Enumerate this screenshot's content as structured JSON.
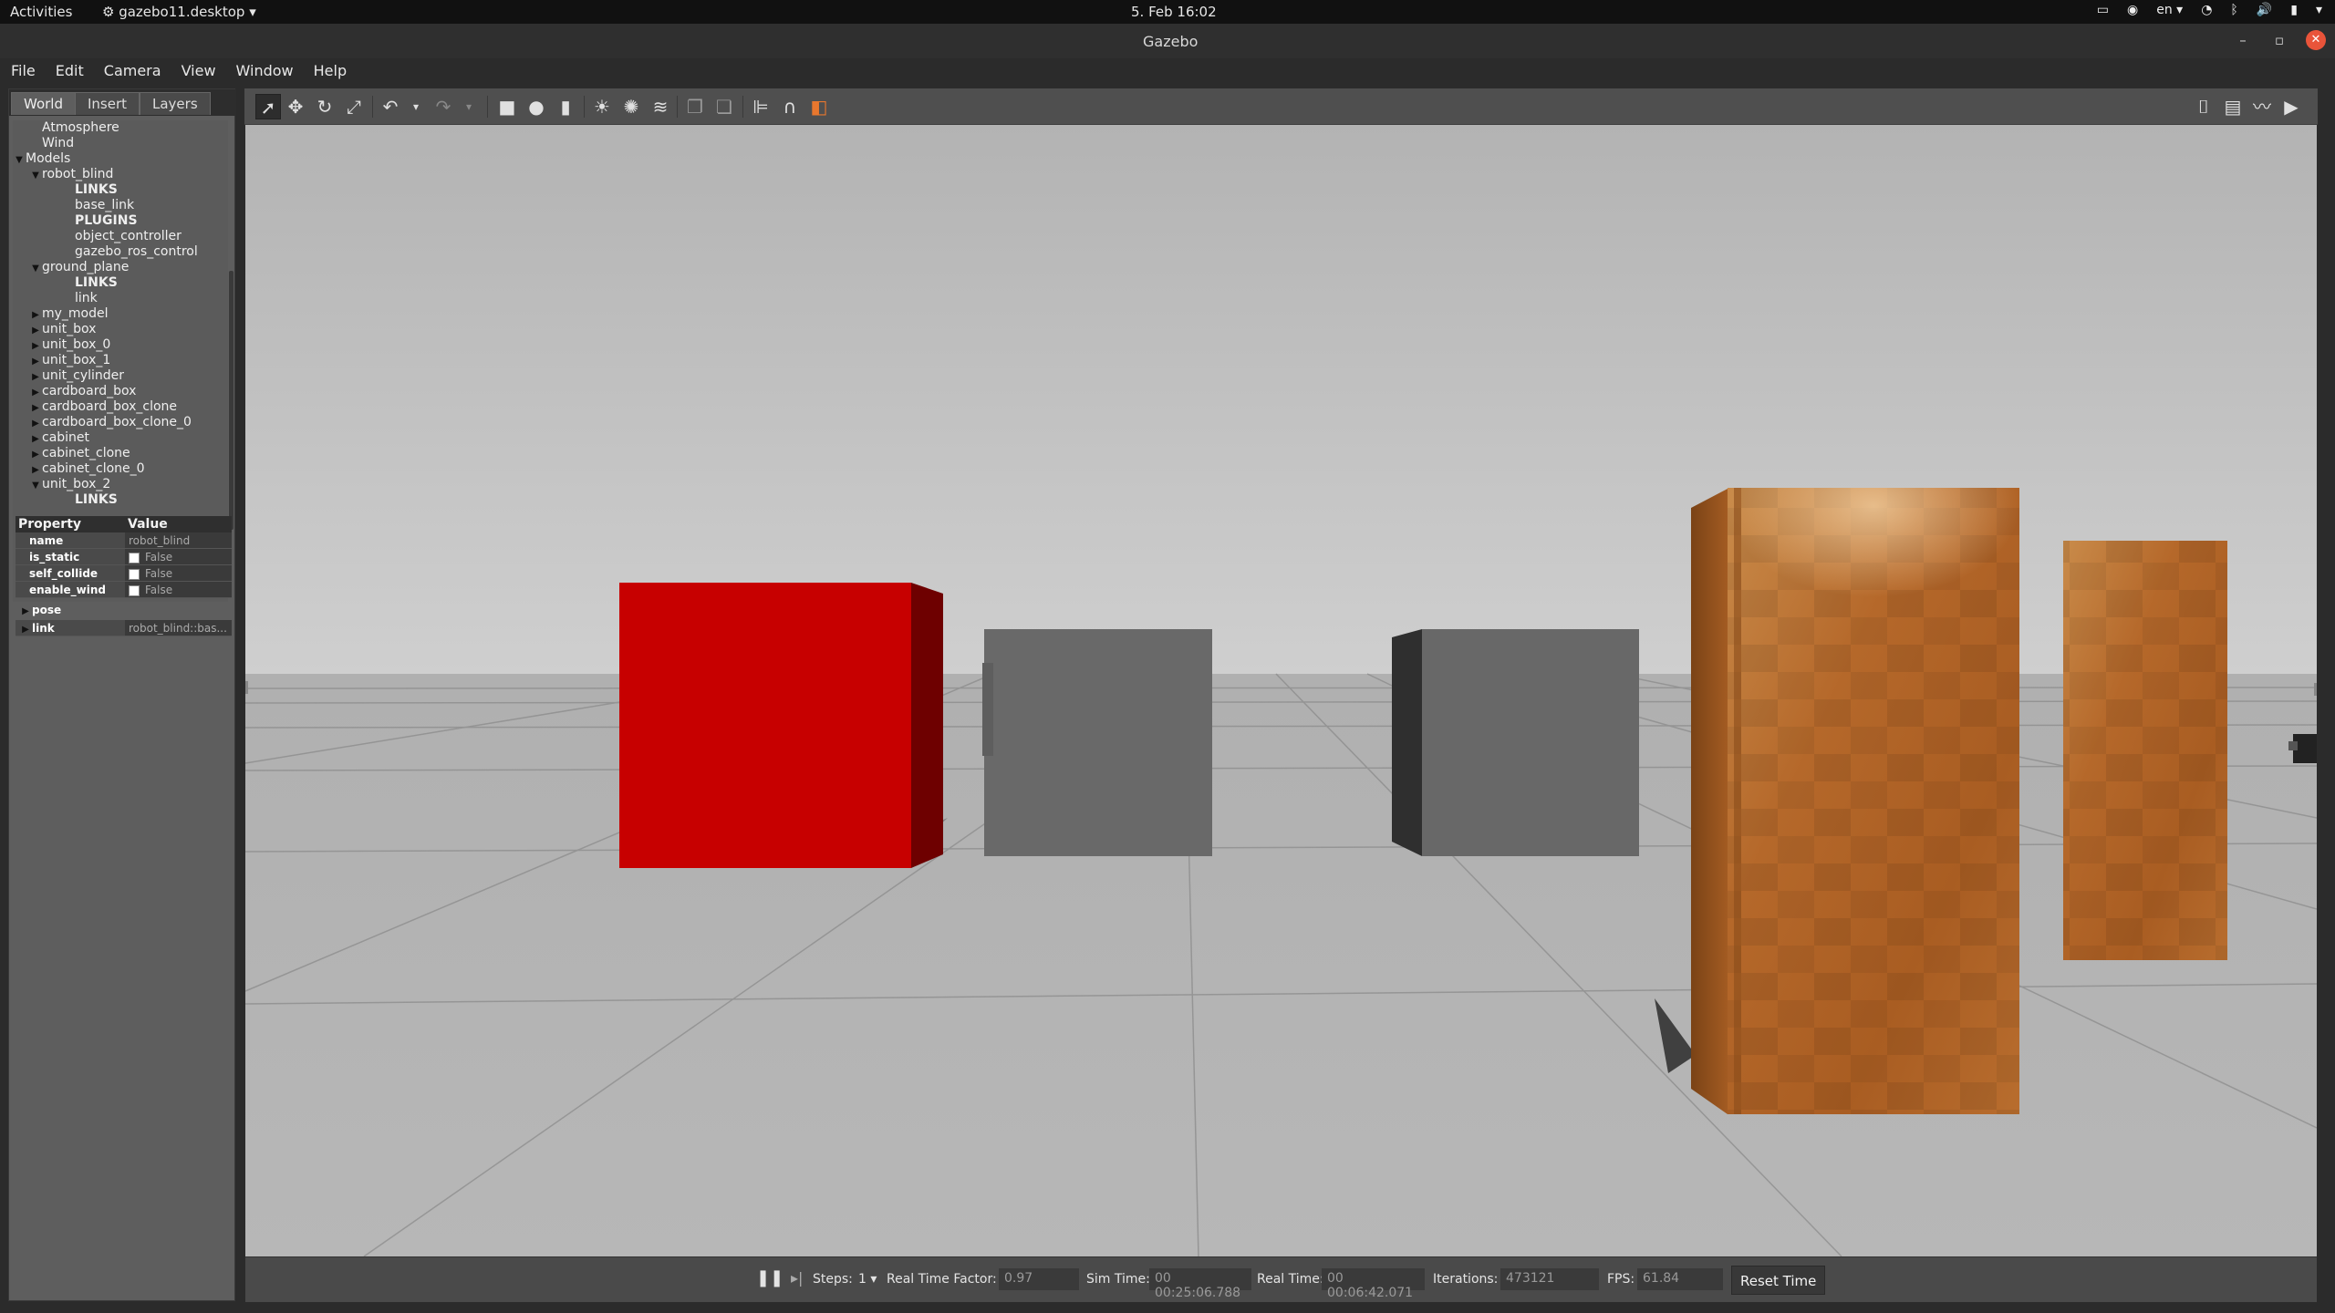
{
  "topbar": {
    "activities": "Activities",
    "app_menu": "gazebo11.desktop",
    "clock": "5. Feb  16:02",
    "lang": "en"
  },
  "window": {
    "title": "Gazebo"
  },
  "menubar": [
    "File",
    "Edit",
    "Camera",
    "View",
    "Window",
    "Help"
  ],
  "left_panel": {
    "tabs": [
      "World",
      "Insert",
      "Layers"
    ],
    "tree": [
      {
        "label": "Atmosphere",
        "indent": 1,
        "caret": "",
        "bold": false
      },
      {
        "label": "Wind",
        "indent": 1,
        "caret": "",
        "bold": false
      },
      {
        "label": "Models",
        "indent": 0,
        "caret": "open",
        "bold": false
      },
      {
        "label": "robot_blind",
        "indent": 1,
        "caret": "open",
        "bold": false
      },
      {
        "label": "LINKS",
        "indent": 3,
        "caret": "",
        "bold": true
      },
      {
        "label": "base_link",
        "indent": 3,
        "caret": "",
        "bold": false
      },
      {
        "label": "PLUGINS",
        "indent": 3,
        "caret": "",
        "bold": true
      },
      {
        "label": "object_controller",
        "indent": 3,
        "caret": "",
        "bold": false
      },
      {
        "label": "gazebo_ros_control",
        "indent": 3,
        "caret": "",
        "bold": false
      },
      {
        "label": "ground_plane",
        "indent": 1,
        "caret": "open",
        "bold": false
      },
      {
        "label": "LINKS",
        "indent": 3,
        "caret": "",
        "bold": true
      },
      {
        "label": "link",
        "indent": 3,
        "caret": "",
        "bold": false
      },
      {
        "label": "my_model",
        "indent": 1,
        "caret": "closed",
        "bold": false
      },
      {
        "label": "unit_box",
        "indent": 1,
        "caret": "closed",
        "bold": false
      },
      {
        "label": "unit_box_0",
        "indent": 1,
        "caret": "closed",
        "bold": false
      },
      {
        "label": "unit_box_1",
        "indent": 1,
        "caret": "closed",
        "bold": false
      },
      {
        "label": "unit_cylinder",
        "indent": 1,
        "caret": "closed",
        "bold": false
      },
      {
        "label": "cardboard_box",
        "indent": 1,
        "caret": "closed",
        "bold": false
      },
      {
        "label": "cardboard_box_clone",
        "indent": 1,
        "caret": "closed",
        "bold": false
      },
      {
        "label": "cardboard_box_clone_0",
        "indent": 1,
        "caret": "closed",
        "bold": false
      },
      {
        "label": "cabinet",
        "indent": 1,
        "caret": "closed",
        "bold": false
      },
      {
        "label": "cabinet_clone",
        "indent": 1,
        "caret": "closed",
        "bold": false
      },
      {
        "label": "cabinet_clone_0",
        "indent": 1,
        "caret": "closed",
        "bold": false
      },
      {
        "label": "unit_box_2",
        "indent": 1,
        "caret": "open",
        "bold": false
      },
      {
        "label": "LINKS",
        "indent": 3,
        "caret": "",
        "bold": true
      }
    ],
    "properties": {
      "header": {
        "property": "Property",
        "value": "Value"
      },
      "name_key": "name",
      "name_val": "robot_blind",
      "is_static_key": "is_static",
      "is_static_val": "False",
      "self_collide_key": "self_collide",
      "self_collide_val": "False",
      "enable_wind_key": "enable_wind",
      "enable_wind_val": "False",
      "pose_key": "pose",
      "link_key": "link",
      "link_val": "robot_blind::bas..."
    }
  },
  "bottom_bar": {
    "steps_label": "Steps:",
    "steps_value": "1",
    "rtf_label": "Real Time Factor:",
    "rtf_value": "0.97",
    "sim_time_label": "Sim Time:",
    "sim_time_value": "00 00:25:06.788",
    "real_time_label": "Real Time:",
    "real_time_value": "00 00:06:42.071",
    "iterations_label": "Iterations:",
    "iterations_value": "473121",
    "fps_label": "FPS:",
    "fps_value": "61.84",
    "reset_label": "Reset Time"
  },
  "colors": {
    "red_box": "#c80000",
    "gray_box": "#6a6a6a",
    "cabinet_wood": "#b8692a"
  }
}
